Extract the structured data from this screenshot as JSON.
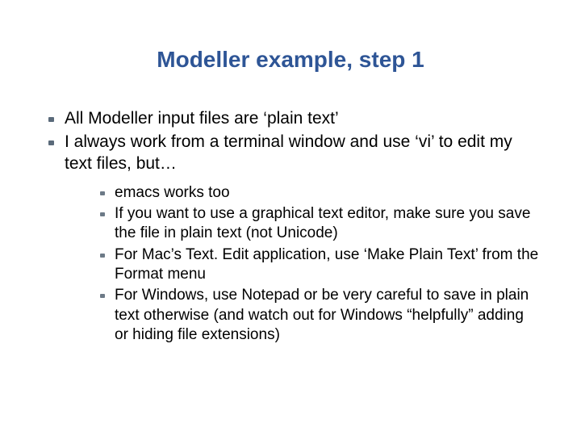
{
  "title": "Modeller example, step 1",
  "outer": [
    "All Modeller input files are ‘plain text’",
    "I always work from a terminal window and use ‘vi’ to edit my text files, but…"
  ],
  "inner": [
    "emacs works too",
    "If you want to use a graphical text editor, make sure you save the file in plain text (not Unicode)",
    "For Mac’s Text. Edit application, use ‘Make Plain Text’ from the Format menu",
    "For Windows, use Notepad or be very careful to save in plain text otherwise (and watch out for Windows “helpfully” adding or hiding file extensions)"
  ]
}
